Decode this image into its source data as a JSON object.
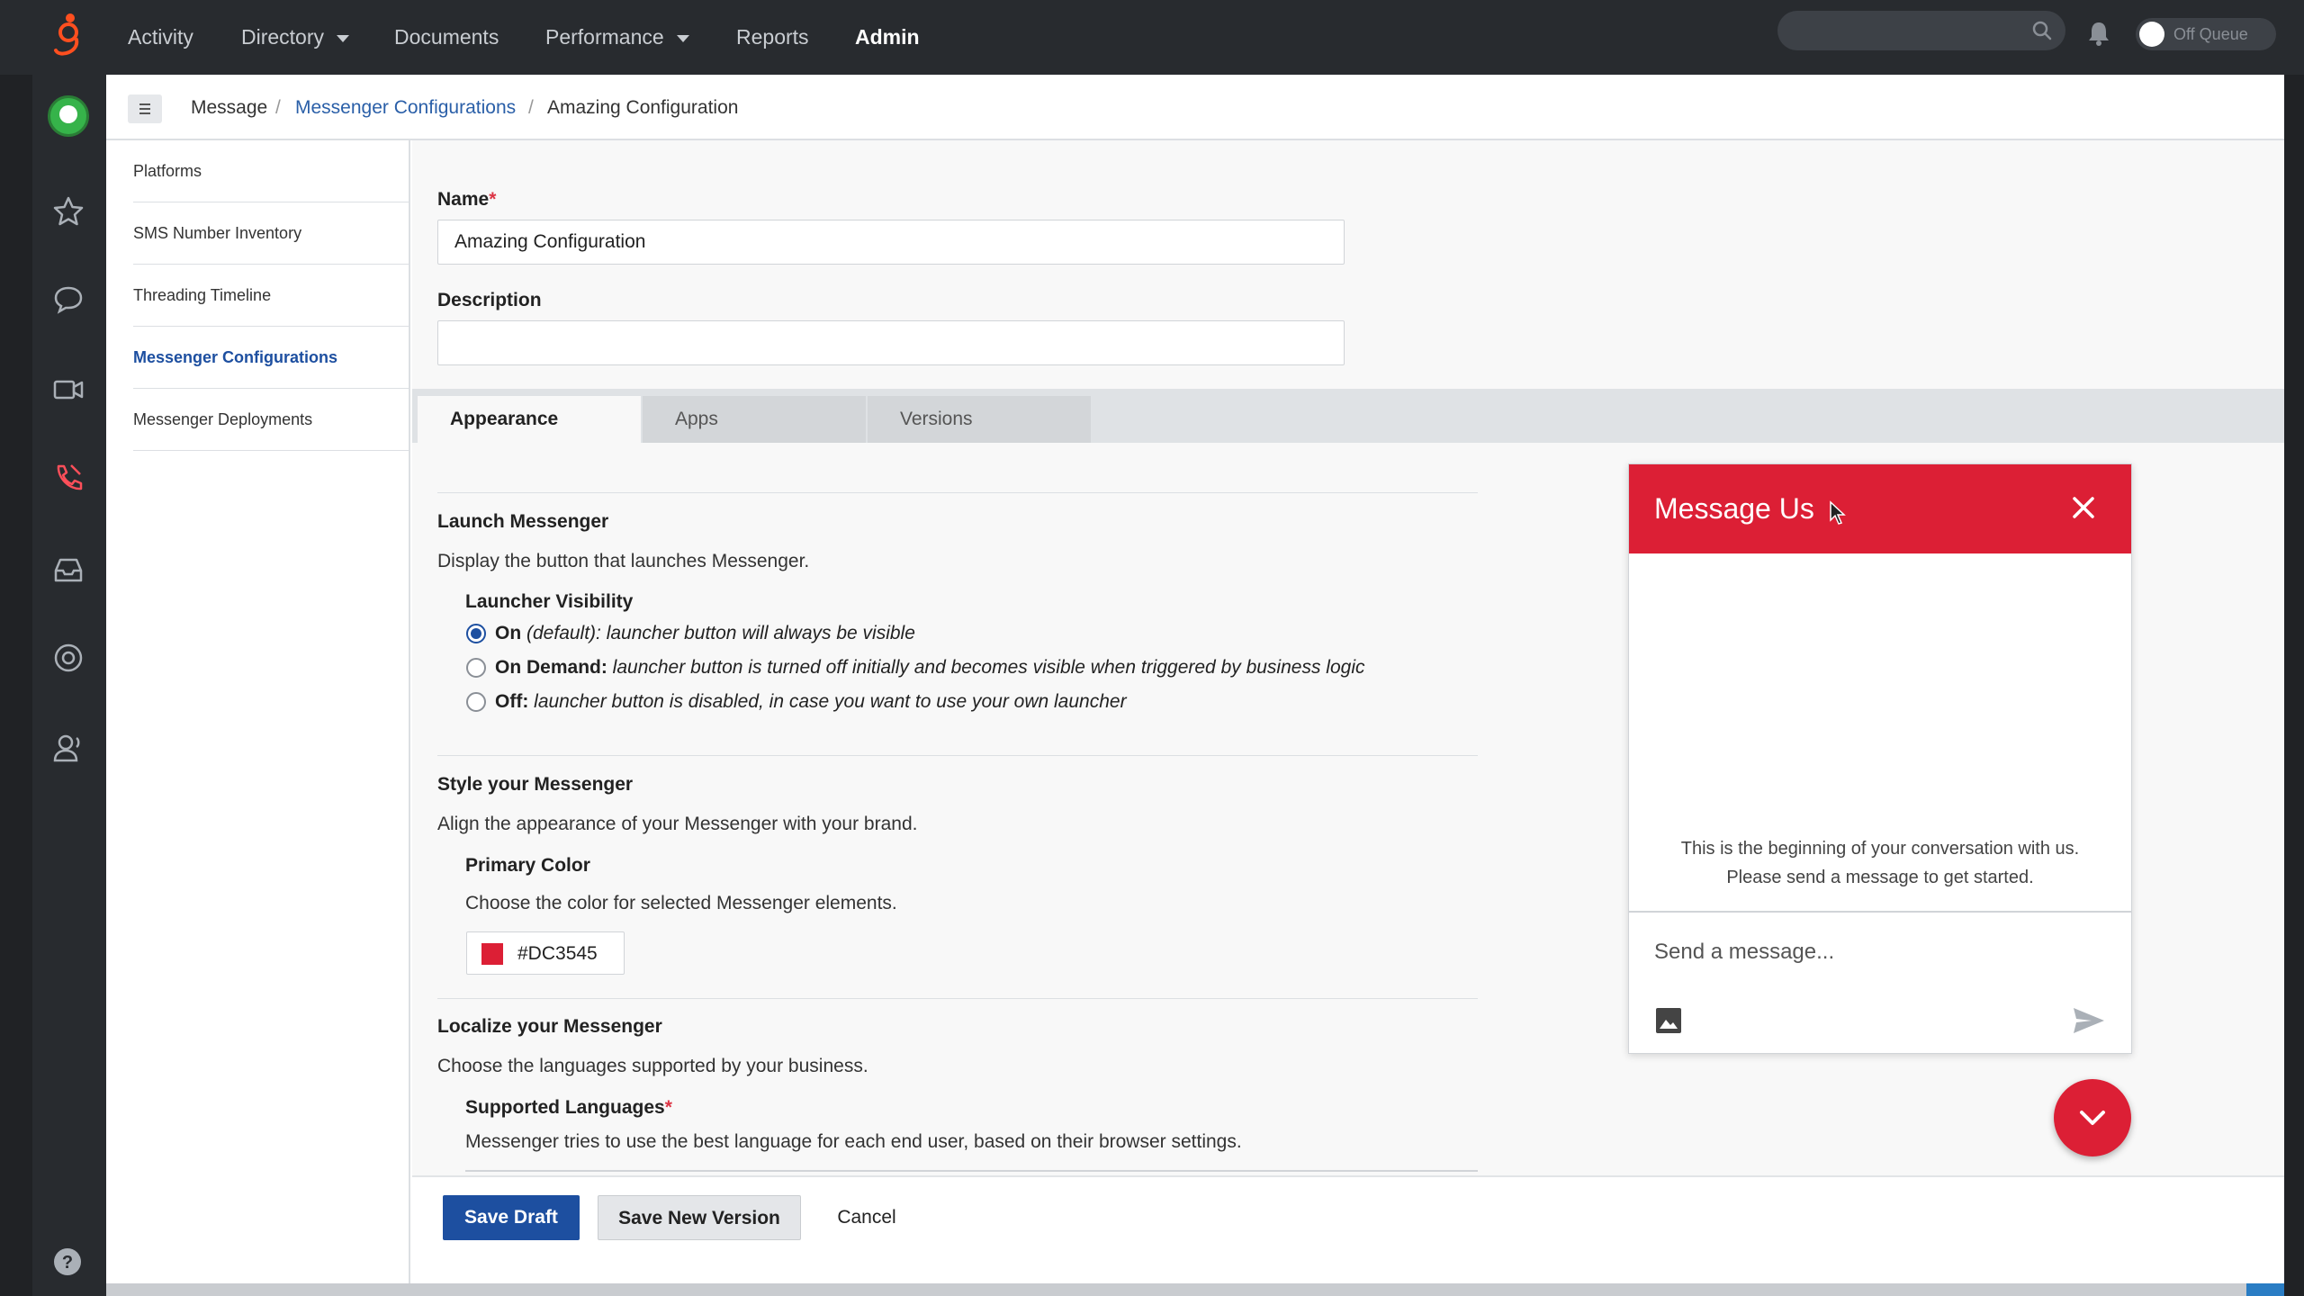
{
  "topnav": {
    "items": [
      {
        "label": "Activity",
        "dropdown": false
      },
      {
        "label": "Directory",
        "dropdown": true
      },
      {
        "label": "Documents",
        "dropdown": false
      },
      {
        "label": "Performance",
        "dropdown": true
      },
      {
        "label": "Reports",
        "dropdown": false
      },
      {
        "label": "Admin",
        "dropdown": false,
        "active": true
      }
    ],
    "queue_label": "Off Queue"
  },
  "breadcrumb": {
    "root": "Message",
    "parent": "Messenger Configurations",
    "current": "Amazing Configuration",
    "separator": "/"
  },
  "subnav": {
    "items": [
      {
        "label": "Platforms"
      },
      {
        "label": "SMS Number Inventory"
      },
      {
        "label": "Threading Timeline"
      },
      {
        "label": "Messenger Configurations",
        "active": true
      },
      {
        "label": "Messenger Deployments"
      }
    ]
  },
  "form": {
    "name_label": "Name",
    "required_mark": "*",
    "name_value": "Amazing Configuration",
    "description_label": "Description",
    "description_value": ""
  },
  "tabs": [
    {
      "label": "Appearance",
      "active": true
    },
    {
      "label": "Apps"
    },
    {
      "label": "Versions"
    }
  ],
  "launch": {
    "title": "Launch Messenger",
    "desc": "Display the button that launches Messenger.",
    "visibility_label": "Launcher Visibility",
    "options": [
      {
        "bold": "On",
        "italic": " (default): launcher button will always be visible",
        "checked": true
      },
      {
        "bold": "On Demand:",
        "italic": " launcher button is turned off initially and becomes visible when triggered by business logic",
        "checked": false
      },
      {
        "bold": "Off:",
        "italic": " launcher button is disabled, in case you want to use your own launcher",
        "checked": false
      }
    ]
  },
  "style": {
    "title": "Style your Messenger",
    "desc": "Align the appearance of your Messenger with your brand.",
    "primary_label": "Primary Color",
    "primary_desc": "Choose the color for selected Messenger elements.",
    "primary_value": "#DC3545"
  },
  "localize": {
    "title": "Localize your Messenger",
    "desc": "Choose the languages supported by your business.",
    "languages_label": "Supported Languages",
    "languages_desc": "Messenger tries to use the best language for each end user, based on their browser settings."
  },
  "footer": {
    "save_draft": "Save Draft",
    "save_version": "Save New Version",
    "cancel": "Cancel"
  },
  "messenger": {
    "title": "Message Us",
    "info_line1": "This is the beginning of your conversation with us.",
    "info_line2": "Please send a message to get started.",
    "placeholder": "Send a message..."
  },
  "colors": {
    "brand_red": "#dc1f35",
    "primary_blue": "#1d4fa0",
    "topbar": "#282b2f",
    "link": "#2a5fa8"
  }
}
